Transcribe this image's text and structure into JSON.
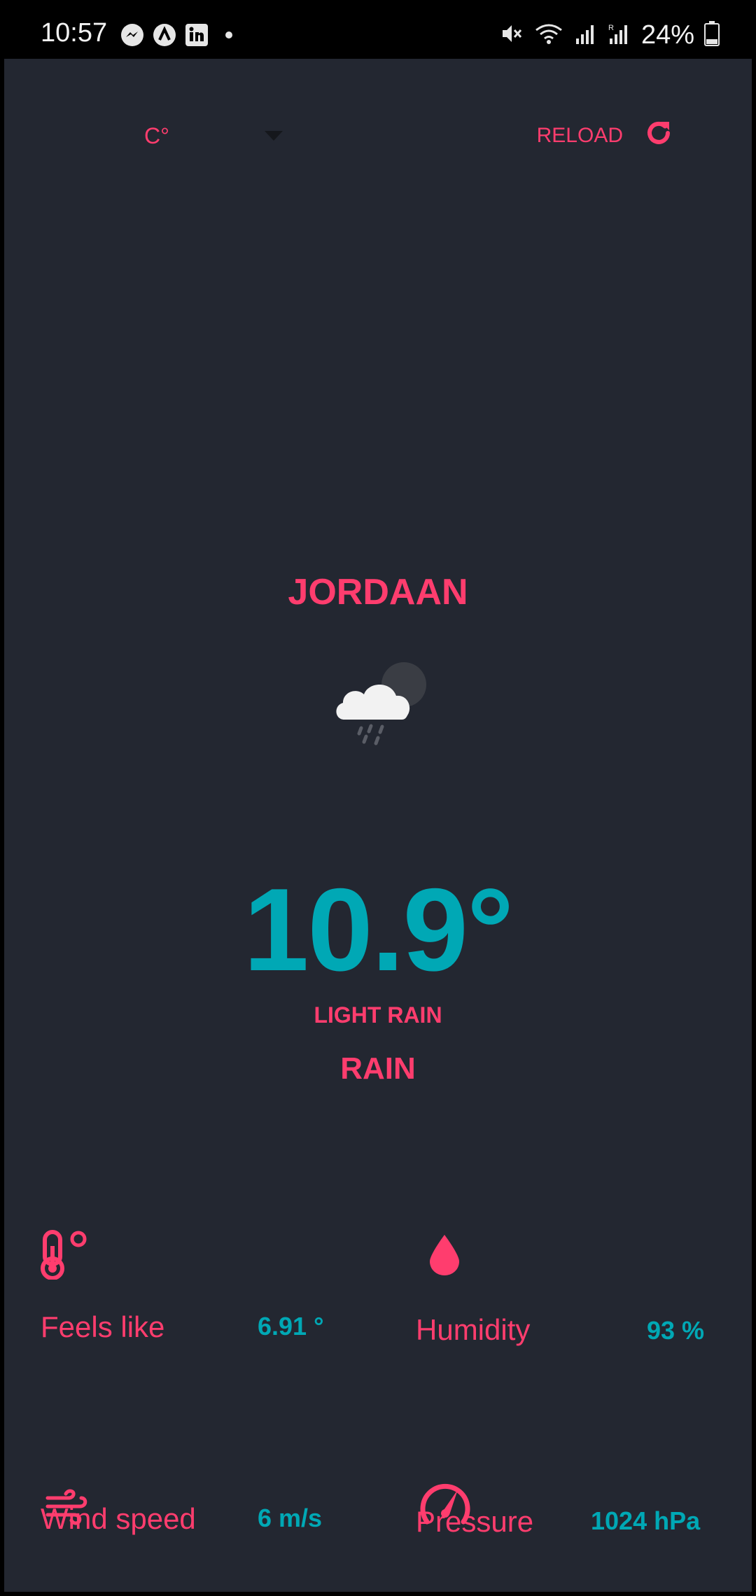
{
  "status_bar": {
    "time": "10:57",
    "notification_icons": [
      "messenger-icon",
      "app-a-icon",
      "linkedin-icon",
      "more-dot-icon"
    ],
    "system_icons": [
      "mute-icon",
      "wifi-icon",
      "signal-icon",
      "signal-r-icon"
    ],
    "battery_percent": "24%"
  },
  "toolbar": {
    "unit_selected": "C°",
    "reload_label": "RELOAD"
  },
  "weather": {
    "city": "JORDAAN",
    "icon": "cloud-rain-night-icon",
    "temperature": "10.9°",
    "description": "LIGHT RAIN",
    "main": "RAIN"
  },
  "stats": {
    "feels_like": {
      "label": "Feels like",
      "value": "6.91 °",
      "icon": "thermometer-icon"
    },
    "humidity": {
      "label": "Humidity",
      "value": "93 %",
      "icon": "water-drop-icon"
    },
    "wind_speed": {
      "label": "Wind speed",
      "value": "6 m/s",
      "icon": "wind-icon"
    },
    "pressure": {
      "label": "Pressure",
      "value": "1024 hPa",
      "icon": "gauge-icon"
    }
  },
  "colors": {
    "background": "#232731",
    "accent_pink": "#ff3d6e",
    "accent_teal": "#00a8b5"
  }
}
